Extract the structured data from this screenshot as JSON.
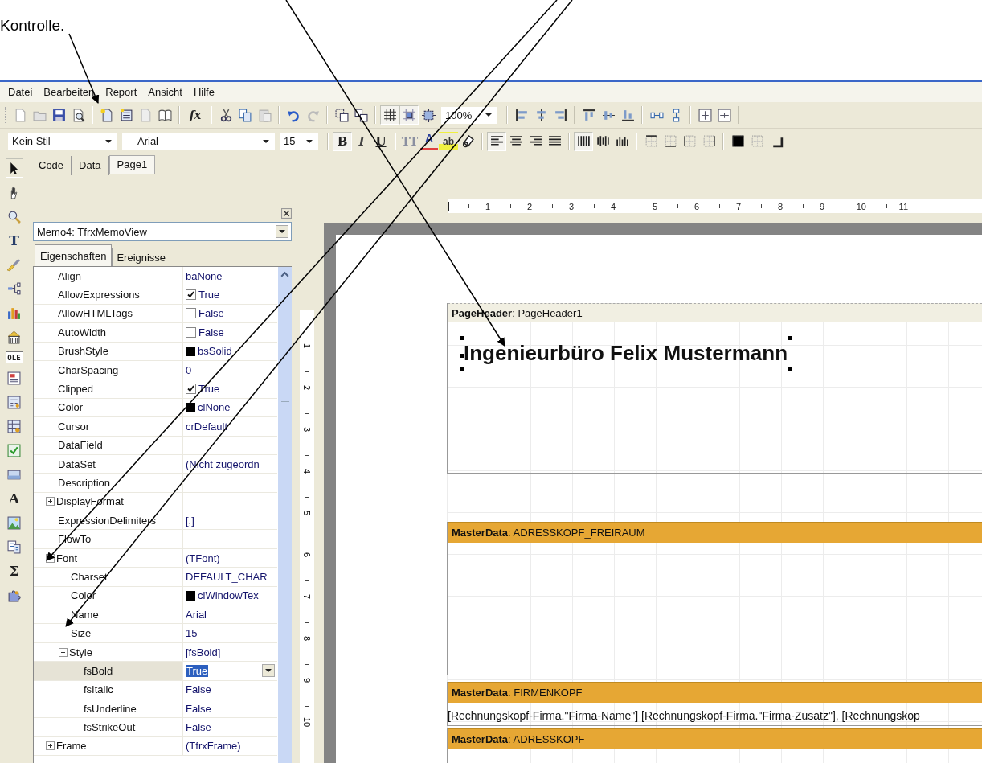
{
  "note": {
    "text": "Kontrolle."
  },
  "menu": [
    {
      "label": "Datei"
    },
    {
      "label": "Bearbeiten"
    },
    {
      "label": "Report"
    },
    {
      "label": "Ansicht"
    },
    {
      "label": "Hilfe"
    }
  ],
  "toolbar_main": [
    {
      "kind": "icon",
      "pressed": false
    },
    {
      "kind": "icon",
      "pressed": false
    },
    {
      "kind": "icon",
      "pressed": false
    },
    {
      "kind": "icon",
      "pressed": false
    },
    {
      "kind": "sep"
    },
    {
      "kind": "icon",
      "pressed": false
    },
    {
      "kind": "icon",
      "pressed": false
    },
    {
      "kind": "icon",
      "pressed": false
    },
    {
      "kind": "icon",
      "pressed": false
    },
    {
      "kind": "sep"
    },
    {
      "kind": "glyph",
      "label": "fx",
      "pressed": false
    },
    {
      "kind": "sep"
    },
    {
      "kind": "icon",
      "pressed": false
    },
    {
      "kind": "icon",
      "pressed": false
    },
    {
      "kind": "icon",
      "pressed": false
    },
    {
      "kind": "sep"
    },
    {
      "kind": "icon",
      "pressed": false
    },
    {
      "kind": "icon",
      "pressed": false
    },
    {
      "kind": "sep"
    },
    {
      "kind": "icon",
      "pressed": false
    },
    {
      "kind": "icon",
      "pressed": false
    },
    {
      "kind": "sep"
    },
    {
      "kind": "icon",
      "pressed": true
    },
    {
      "kind": "icon",
      "pressed": true
    },
    {
      "kind": "icon",
      "pressed": false
    },
    {
      "kind": "combo",
      "value": "100%"
    },
    {
      "kind": "sep"
    },
    {
      "kind": "icon",
      "pressed": false
    },
    {
      "kind": "icon",
      "pressed": false
    },
    {
      "kind": "icon",
      "pressed": false
    },
    {
      "kind": "sep"
    },
    {
      "kind": "icon",
      "pressed": false
    },
    {
      "kind": "icon",
      "pressed": false
    },
    {
      "kind": "icon",
      "pressed": false
    },
    {
      "kind": "sep"
    },
    {
      "kind": "icon",
      "pressed": false
    },
    {
      "kind": "icon",
      "pressed": false
    },
    {
      "kind": "sep"
    },
    {
      "kind": "icon",
      "pressed": false
    },
    {
      "kind": "icon",
      "pressed": false
    },
    {
      "kind": "sep"
    }
  ],
  "toolbar_format": [
    {
      "kind": "combo",
      "value": "Kein Stil"
    },
    {
      "kind": "combo",
      "value": "Arial"
    },
    {
      "kind": "combo",
      "value": "15"
    },
    {
      "kind": "sep"
    },
    {
      "kind": "glyph",
      "label": "B",
      "pressed": true
    },
    {
      "kind": "glyph",
      "label": "I",
      "pressed": false
    },
    {
      "kind": "glyph",
      "label": "U",
      "pressed": false
    },
    {
      "kind": "sep"
    },
    {
      "kind": "glyph",
      "label": "TT",
      "pressed": false
    },
    {
      "kind": "glyph",
      "label": "A",
      "pressed": false
    },
    {
      "kind": "glyph",
      "label": "ab",
      "pressed": false
    },
    {
      "kind": "icon",
      "pressed": false
    },
    {
      "kind": "sep"
    },
    {
      "kind": "icon",
      "pressed": true
    },
    {
      "kind": "icon",
      "pressed": false
    },
    {
      "kind": "icon",
      "pressed": false
    },
    {
      "kind": "icon",
      "pressed": false
    },
    {
      "kind": "sep"
    },
    {
      "kind": "icon",
      "pressed": true
    },
    {
      "kind": "icon",
      "pressed": false
    },
    {
      "kind": "icon",
      "pressed": false
    },
    {
      "kind": "sep"
    },
    {
      "kind": "icon",
      "pressed": false
    },
    {
      "kind": "icon",
      "pressed": false
    },
    {
      "kind": "icon",
      "pressed": false
    },
    {
      "kind": "icon",
      "pressed": false
    },
    {
      "kind": "sep"
    },
    {
      "kind": "icon",
      "pressed": false
    },
    {
      "kind": "icon",
      "pressed": false
    },
    {
      "kind": "icon",
      "pressed": false
    }
  ],
  "toolbox": [
    {
      "kind": "icon",
      "selected": true
    },
    {
      "kind": "icon",
      "selected": false
    },
    {
      "kind": "icon",
      "selected": false
    },
    {
      "kind": "text",
      "label": "T",
      "selected": false
    },
    {
      "kind": "icon",
      "selected": false
    },
    {
      "kind": "icon",
      "selected": false
    },
    {
      "kind": "icon",
      "selected": false
    },
    {
      "kind": "icon",
      "selected": false
    },
    {
      "kind": "text",
      "label": "OLE",
      "selected": false
    },
    {
      "kind": "icon",
      "selected": false
    },
    {
      "kind": "icon",
      "selected": false
    },
    {
      "kind": "icon",
      "selected": false
    },
    {
      "kind": "icon",
      "selected": false
    },
    {
      "kind": "icon",
      "selected": false
    },
    {
      "kind": "text",
      "label": "A",
      "selected": false
    },
    {
      "kind": "icon",
      "selected": false
    },
    {
      "kind": "icon",
      "selected": false
    },
    {
      "kind": "text",
      "label": "Σ",
      "selected": false
    },
    {
      "kind": "icon",
      "selected": false
    }
  ],
  "tabs": [
    {
      "label": "Code",
      "selected": false
    },
    {
      "label": "Data",
      "selected": false
    },
    {
      "label": "Page1",
      "selected": true
    }
  ],
  "inspector": {
    "object": "Memo4: TfrxMemoView",
    "tabs": [
      {
        "label": "Eigenschaften",
        "selected": true
      },
      {
        "label": "Ereignisse",
        "selected": false
      }
    ],
    "properties": [
      {
        "name": "Align",
        "value": "baNone",
        "kind": "text",
        "selected": false
      },
      {
        "name": "AllowExpressions",
        "value": "True",
        "kind": "check",
        "checked": true,
        "selected": false
      },
      {
        "name": "AllowHTMLTags",
        "value": "False",
        "kind": "check",
        "checked": false,
        "selected": false
      },
      {
        "name": "AutoWidth",
        "value": "False",
        "kind": "check",
        "checked": false,
        "selected": false
      },
      {
        "name": "BrushStyle",
        "value": "bsSolid",
        "kind": "swatch",
        "selected": false
      },
      {
        "name": "CharSpacing",
        "value": "0",
        "kind": "text",
        "selected": false
      },
      {
        "name": "Clipped",
        "value": "True",
        "kind": "check",
        "checked": true,
        "selected": false
      },
      {
        "name": "Color",
        "value": "clNone",
        "kind": "swatch",
        "selected": false
      },
      {
        "name": "Cursor",
        "value": "crDefault",
        "kind": "text",
        "selected": false
      },
      {
        "name": "DataField",
        "kind": "text",
        "selected": false
      },
      {
        "name": "DataSet",
        "value": "(Nicht zugeordn",
        "kind": "text",
        "selected": false
      },
      {
        "name": "Description",
        "kind": "text",
        "selected": false
      },
      {
        "name": "DisplayFormat",
        "kind": "text",
        "expanded": false,
        "selected": false
      },
      {
        "name": "ExpressionDelimiters",
        "value": "[,]",
        "kind": "text",
        "selected": false
      },
      {
        "name": "FlowTo",
        "kind": "text",
        "selected": false
      },
      {
        "name": "Font",
        "value": "(TFont)",
        "kind": "text",
        "expanded": true,
        "selected": false,
        "children": [
          {
            "name": "Charset",
            "value": "DEFAULT_CHAR",
            "kind": "text",
            "selected": false
          },
          {
            "name": "Color",
            "value": "clWindowTex",
            "kind": "swatch",
            "selected": false
          },
          {
            "name": "Name",
            "value": "Arial",
            "kind": "text",
            "selected": false
          },
          {
            "name": "Size",
            "value": "15",
            "kind": "text",
            "selected": false
          },
          {
            "name": "Style",
            "value": "[fsBold]",
            "kind": "text",
            "expanded": true,
            "selected": false,
            "children": [
              {
                "name": "fsBold",
                "value": "True",
                "kind": "dropdown",
                "selected": true
              },
              {
                "name": "fsItalic",
                "value": "False",
                "kind": "text",
                "selected": false
              },
              {
                "name": "fsUnderline",
                "value": "False",
                "kind": "text",
                "selected": false
              },
              {
                "name": "fsStrikeOut",
                "value": "False",
                "kind": "text",
                "selected": false
              }
            ]
          }
        ]
      },
      {
        "name": "Frame",
        "value": "(TfrxFrame)",
        "kind": "text",
        "expanded": false,
        "selected": false
      }
    ]
  },
  "rulers": {
    "horizontal": [
      "1",
      "2",
      "3",
      "4",
      "5",
      "6",
      "7",
      "8",
      "9",
      "10",
      "11"
    ],
    "vertical": [
      "1",
      "2",
      "3",
      "4",
      "5",
      "6",
      "7",
      "8",
      "9",
      "10"
    ]
  },
  "bands": [
    {
      "kind": "page_header",
      "title": "**PageHeader**: PageHeader1",
      "color": "#f1efe2",
      "memos": [
        {
          "text": "Ingenieurbüro Felix Mustermann",
          "kind": "title",
          "selected": true
        }
      ]
    },
    {
      "kind": "master_data",
      "title": "**MasterData**: ADRESSKOPF_FREIRAUM",
      "color": "#e6a734"
    },
    {
      "kind": "master_data",
      "title": "**MasterData**: FIRMENKOPF",
      "color": "#e6a734",
      "memos": [
        {
          "text": "[Rechnungskopf-Firma.\"Firma-Name\"] [Rechnungskopf-Firma.\"Firma-Zusatz\"], [Rechnungskop",
          "kind": "field",
          "selected": false
        }
      ]
    },
    {
      "kind": "master_data",
      "title": "**MasterData**: ADRESSKOPF",
      "color": "#e6a734"
    }
  ]
}
